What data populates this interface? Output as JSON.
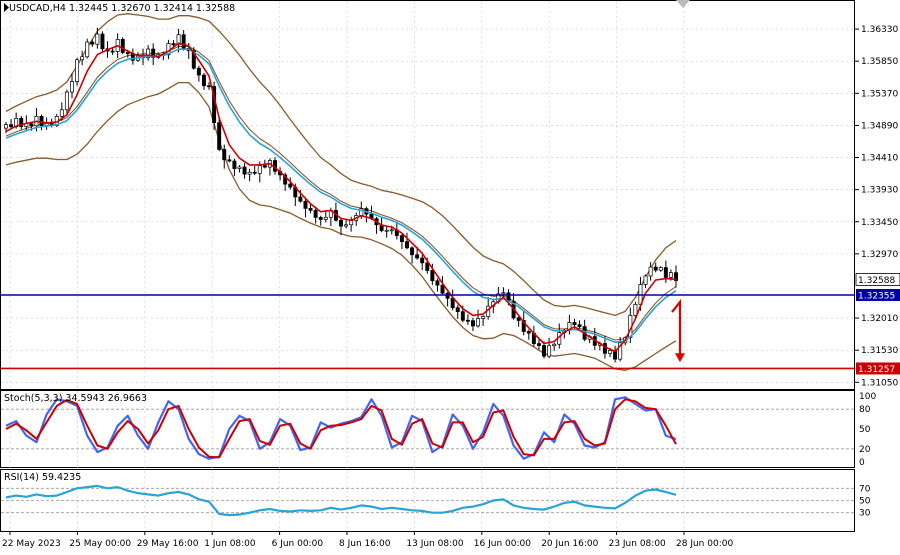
{
  "symbol_header": "USDCAD,H4  1.32445 1.32670 1.32414 1.32588",
  "current_price_tag": "1.32588",
  "colors": {
    "candle": "#000000",
    "ma_fast": "#cc0000",
    "ma_slow": "#29a3d9",
    "bollinger": "#8b5a2b",
    "support_line": "#0000aa",
    "target_line": "#cc0000",
    "stoch_main": "#4466ee",
    "stoch_signal": "#cc0000",
    "rsi_line": "#29a3d9",
    "arrow": "#dd0000",
    "grid": "#c8c8c8"
  },
  "chart_data": [
    {
      "type": "candlestick",
      "title": "USDCAD,H4",
      "ohlc_latest": {
        "open": 1.32445,
        "high": 1.3267,
        "low": 1.32414,
        "close": 1.32588
      },
      "y_ticks": [
        "1.36330",
        "1.35850",
        "1.35370",
        "1.34890",
        "1.34410",
        "1.33930",
        "1.33450",
        "1.32970",
        "1.32010",
        "1.31530",
        "1.31050"
      ],
      "ylim": [
        1.3095,
        1.3675
      ],
      "x_labels": [
        "22 May 2023",
        "25 May 00:00",
        "29 May 16:00",
        "1 Jun 08:00",
        "6 Jun 00:00",
        "8 Jun 16:00",
        "13 Jun 08:00",
        "16 Jun 00:00",
        "20 Jun 16:00",
        "23 Jun 08:00",
        "28 Jun 00:00"
      ],
      "close_path": [
        1.3485,
        1.3498,
        1.3492,
        1.3502,
        1.3488,
        1.3495,
        1.353,
        1.358,
        1.361,
        1.3625,
        1.36,
        1.3615,
        1.359,
        1.3585,
        1.3595,
        1.359,
        1.361,
        1.3625,
        1.36,
        1.356,
        1.354,
        1.3445,
        1.343,
        1.3425,
        1.342,
        1.343,
        1.3435,
        1.341,
        1.339,
        1.337,
        1.336,
        1.335,
        1.3365,
        1.334,
        1.3345,
        1.336,
        1.3345,
        1.333,
        1.3335,
        1.332,
        1.33,
        1.3285,
        1.3255,
        1.3235,
        1.3215,
        1.32,
        1.3195,
        1.321,
        1.323,
        1.324,
        1.32,
        1.318,
        1.3165,
        1.315,
        1.317,
        1.319,
        1.3195,
        1.317,
        1.316,
        1.315,
        1.3145,
        1.318,
        1.323,
        1.327,
        1.3275,
        1.3262,
        1.3258
      ],
      "ma_fast_path": [
        1.348,
        1.3488,
        1.3492,
        1.3495,
        1.3493,
        1.3494,
        1.3505,
        1.3535,
        1.357,
        1.3595,
        1.3602,
        1.3608,
        1.36,
        1.3593,
        1.3594,
        1.3592,
        1.36,
        1.3612,
        1.3608,
        1.3586,
        1.3563,
        1.35,
        1.346,
        1.344,
        1.343,
        1.343,
        1.3432,
        1.342,
        1.3405,
        1.3388,
        1.3372,
        1.336,
        1.3362,
        1.335,
        1.3347,
        1.3354,
        1.335,
        1.334,
        1.3337,
        1.3328,
        1.3313,
        1.3298,
        1.3275,
        1.3253,
        1.3232,
        1.3215,
        1.3205,
        1.3207,
        1.322,
        1.3232,
        1.3215,
        1.3195,
        1.3178,
        1.3163,
        1.3166,
        1.318,
        1.3188,
        1.3178,
        1.3168,
        1.3158,
        1.3151,
        1.3168,
        1.32,
        1.3238,
        1.3258,
        1.326,
        1.3259
      ],
      "ma_slow_path": [
        1.347,
        1.3476,
        1.3481,
        1.3486,
        1.3488,
        1.349,
        1.3496,
        1.3512,
        1.3533,
        1.3555,
        1.357,
        1.3582,
        1.3588,
        1.359,
        1.3592,
        1.3592,
        1.3596,
        1.3603,
        1.3603,
        1.3594,
        1.3581,
        1.3548,
        1.3518,
        1.3494,
        1.3475,
        1.3462,
        1.3453,
        1.3441,
        1.3428,
        1.3414,
        1.3401,
        1.3389,
        1.3382,
        1.3372,
        1.3365,
        1.3362,
        1.3358,
        1.3352,
        1.3347,
        1.334,
        1.333,
        1.3319,
        1.3304,
        1.3288,
        1.3271,
        1.3255,
        1.3241,
        1.3232,
        1.3229,
        1.323,
        1.3223,
        1.3212,
        1.32,
        1.3188,
        1.3182,
        1.3182,
        1.3184,
        1.3181,
        1.3177,
        1.3171,
        1.3165,
        1.3167,
        1.318,
        1.32,
        1.3218,
        1.3232,
        1.3242
      ],
      "bollinger_offset_path": [
        0.004,
        0.0042,
        0.0044,
        0.0046,
        0.0048,
        0.0052,
        0.0058,
        0.0066,
        0.0072,
        0.0075,
        0.0074,
        0.0072,
        0.0068,
        0.0064,
        0.006,
        0.0056,
        0.0052,
        0.005,
        0.005,
        0.0056,
        0.0064,
        0.0082,
        0.0095,
        0.01,
        0.0098,
        0.0092,
        0.0085,
        0.0078,
        0.007,
        0.0064,
        0.0058,
        0.0052,
        0.0048,
        0.0045,
        0.0042,
        0.004,
        0.004,
        0.004,
        0.0042,
        0.0045,
        0.005,
        0.0056,
        0.0062,
        0.0066,
        0.0068,
        0.0068,
        0.0066,
        0.0062,
        0.0058,
        0.0052,
        0.0048,
        0.0045,
        0.0042,
        0.004,
        0.0038,
        0.0036,
        0.0036,
        0.0036,
        0.0036,
        0.0038,
        0.004,
        0.0044,
        0.0052,
        0.0062,
        0.007,
        0.0074,
        0.0075
      ],
      "support_level": 1.32355,
      "target_level": 1.31257,
      "projection_arrow": {
        "from": 1.3225,
        "to": 1.3135
      }
    },
    {
      "type": "line",
      "title": "Stoch(5,3,3) 34.5943 26.9663",
      "ylim": [
        0,
        100
      ],
      "y_ticks": [
        "100",
        "80",
        "50",
        "20",
        "0"
      ],
      "levels": [
        80,
        20
      ],
      "series": [
        {
          "name": "main",
          "values": [
            55,
            62,
            40,
            30,
            72,
            95,
            92,
            85,
            40,
            15,
            22,
            55,
            70,
            40,
            20,
            60,
            92,
            80,
            35,
            12,
            5,
            8,
            50,
            70,
            62,
            20,
            30,
            65,
            55,
            18,
            22,
            60,
            52,
            58,
            62,
            68,
            95,
            70,
            22,
            30,
            70,
            62,
            15,
            25,
            72,
            55,
            20,
            45,
            88,
            70,
            25,
            5,
            12,
            45,
            30,
            72,
            58,
            25,
            22,
            30,
            95,
            98,
            88,
            78,
            80,
            40,
            34.5943
          ]
        },
        {
          "name": "signal",
          "values": [
            50,
            58,
            48,
            35,
            60,
            85,
            94,
            88,
            55,
            25,
            20,
            45,
            62,
            50,
            28,
            48,
            80,
            85,
            50,
            22,
            8,
            7,
            35,
            62,
            65,
            32,
            26,
            55,
            58,
            28,
            20,
            48,
            55,
            56,
            60,
            65,
            85,
            78,
            35,
            26,
            58,
            65,
            28,
            22,
            60,
            60,
            30,
            38,
            75,
            78,
            38,
            12,
            10,
            35,
            35,
            60,
            62,
            35,
            25,
            28,
            80,
            95,
            92,
            82,
            80,
            55,
            26.9663
          ]
        }
      ]
    },
    {
      "type": "line",
      "title": "RSI(14) 59.4235",
      "ylim": [
        0,
        100
      ],
      "y_ticks": [
        "70",
        "50",
        "30"
      ],
      "levels": [
        70,
        50,
        30
      ],
      "series": [
        {
          "name": "RSI",
          "values": [
            55,
            58,
            56,
            60,
            57,
            58,
            64,
            70,
            72,
            74,
            70,
            72,
            66,
            62,
            60,
            58,
            62,
            64,
            60,
            52,
            48,
            28,
            26,
            27,
            30,
            34,
            36,
            33,
            32,
            34,
            33,
            34,
            38,
            35,
            38,
            42,
            40,
            36,
            38,
            36,
            34,
            33,
            30,
            30,
            33,
            38,
            40,
            44,
            50,
            52,
            42,
            38,
            36,
            35,
            40,
            46,
            48,
            42,
            40,
            38,
            37,
            46,
            58,
            66,
            68,
            64,
            59.4235
          ]
        }
      ]
    }
  ]
}
